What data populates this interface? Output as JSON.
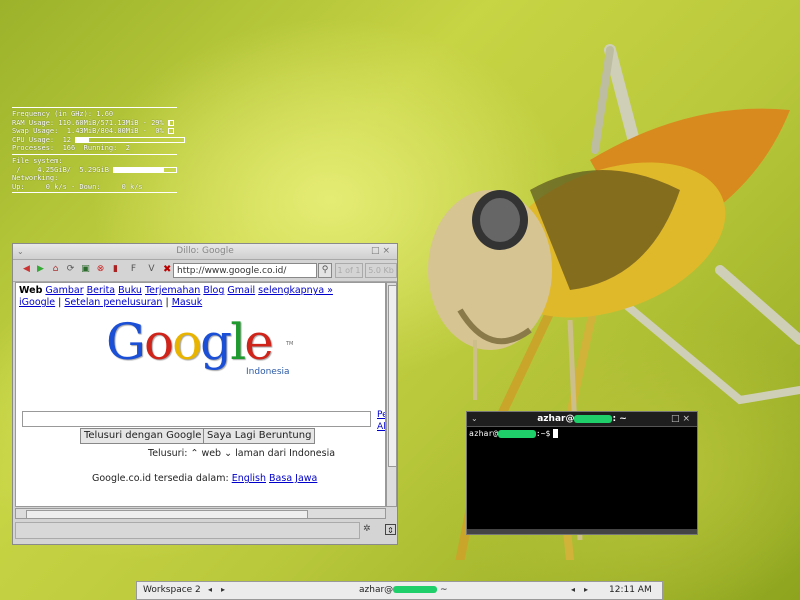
{
  "conky": {
    "rows": [
      "Frequency (in GHz): 1.60",
      "RAM Usage: 110.60MiB/571.13MiB - 29% ",
      "Swap Usage:  1.43MiB/804.00MiB -  0% ",
      "CPU Usage:  12 ",
      "Processes:  166  Running:  2"
    ],
    "fs_label": "File system:",
    "fs_row": " /    4.25GiB/  5.29GiB ",
    "net_label": "Networking:",
    "net_row": "Up:     0 k/s - Down:     0 k/s",
    "ram_pct": 0.29,
    "swap_pct": 0.0,
    "cpu_pct": 0.12,
    "fs_pct": 0.8
  },
  "dillo": {
    "title": "Dillo: Google",
    "url": "http://www.google.co.id/",
    "page_of": "1 of 1",
    "size": "5.0 Kb",
    "toolbar_icons": [
      "back-icon",
      "forward-icon",
      "home-icon",
      "reload-icon",
      "save-icon",
      "stop-icon",
      "bookmarks-icon",
      "find-icon",
      "view-icon"
    ],
    "gbar": {
      "active": "Web",
      "links": [
        "Gambar",
        "Berita",
        "Buku",
        "Terjemahan",
        "Blog",
        "Gmail",
        "selengkapnya »"
      ],
      "line2": [
        "iGoogle",
        "Setelan penelusuran",
        "Masuk"
      ]
    },
    "logo_letters": [
      "G",
      "o",
      "o",
      "g",
      "l",
      "e"
    ],
    "logo_colors": [
      "#1a4fd6",
      "#d0241b",
      "#e8b400",
      "#1a4fd6",
      "#1f9a2e",
      "#d0241b"
    ],
    "logo_sub": "Indonesia",
    "logo_tm": "TM",
    "side_links": [
      "Pe",
      "Al"
    ],
    "buttons": [
      "Telusuri dengan Google",
      "Saya Lagi Beruntung"
    ],
    "search_row": {
      "label": "Telusuri:",
      "opt1": "web",
      "opt2": "laman dari Indonesia"
    },
    "offered": {
      "text": "Google.co.id tersedia dalam:",
      "lang1": "English",
      "lang2": "Basa Jawa"
    }
  },
  "terminal": {
    "title_user": "azhar@",
    "title_suffix": ": ~",
    "prompt_user": "azhar@",
    "prompt_suffix": ":~$"
  },
  "panel": {
    "workspace": "Workspace 2",
    "task_user": "azhar@",
    "task_suffix": " ~",
    "clock": "12:11 AM"
  }
}
